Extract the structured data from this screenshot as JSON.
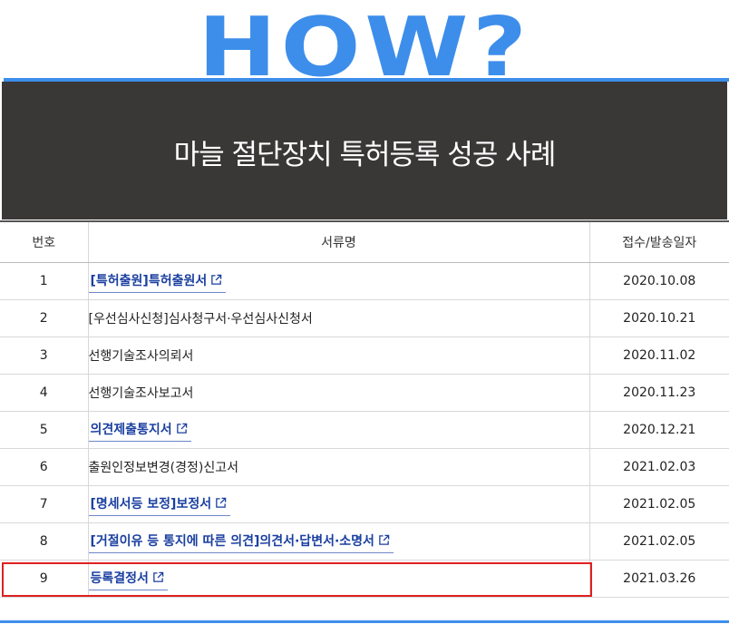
{
  "header": {
    "how_text": "HOW?",
    "banner_title": "마늘 절단장치 특허등록 성공 사례"
  },
  "table": {
    "columns": [
      "번호",
      "서류명",
      "접수/발송일자"
    ],
    "rows": [
      {
        "no": "1",
        "doc": "[특허출원]특허출원서",
        "date": "2020.10.08",
        "link": true
      },
      {
        "no": "2",
        "doc": "[우선심사신청]심사청구서·우선심사신청서",
        "date": "2020.10.21",
        "link": false
      },
      {
        "no": "3",
        "doc": "선행기술조사의뢰서",
        "date": "2020.11.02",
        "link": false
      },
      {
        "no": "4",
        "doc": "선행기술조사보고서",
        "date": "2020.11.23",
        "link": false
      },
      {
        "no": "5",
        "doc": "의견제출통지서",
        "date": "2020.12.21",
        "link": true
      },
      {
        "no": "6",
        "doc": "출원인정보변경(경정)신고서",
        "date": "2021.02.03",
        "link": false
      },
      {
        "no": "7",
        "doc": "[명세서등 보정]보정서",
        "date": "2021.02.05",
        "link": true
      },
      {
        "no": "8",
        "doc": "[거절이유 등 통지에 따른 의견]의견서·답변서·소명서",
        "date": "2021.02.05",
        "link": true
      },
      {
        "no": "9",
        "doc": "등록결정서",
        "date": "2021.03.26",
        "link": true,
        "highlighted": true
      }
    ]
  },
  "colors": {
    "accent_blue": "#3d8eeb",
    "banner_bg": "#3a3737",
    "link_text": "#1a3fa0",
    "highlight_border": "#e02020"
  },
  "icons": {
    "external_link": "external-link-icon"
  }
}
